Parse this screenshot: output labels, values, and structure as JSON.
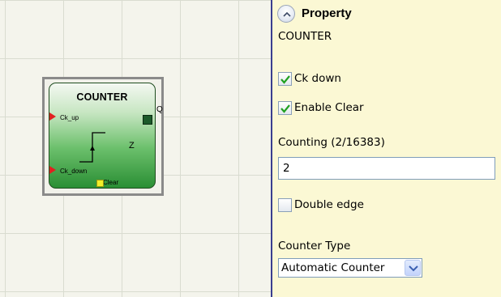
{
  "block": {
    "title": "COUNTER",
    "input_up": "Ck_up",
    "input_down": "Ck_down",
    "output": "Q",
    "value_symbol": "Z",
    "clear_input": "Clear"
  },
  "panel": {
    "header": "Property",
    "block_name": "COUNTER",
    "ck_down": {
      "label": "Ck down",
      "checked": true
    },
    "enable_clear": {
      "label": "Enable Clear",
      "checked": true
    },
    "counting": {
      "label": "Counting (2/16383)",
      "value": "2"
    },
    "double_edge": {
      "label": "Double edge",
      "checked": false
    },
    "counter_type": {
      "label": "Counter Type",
      "selected": "Automatic Counter"
    }
  },
  "colors": {
    "panel_bg": "#fbf8d4",
    "canvas_bg": "#f4f4ec",
    "block_green": "#2a8f34",
    "input_pin": "#e02020",
    "output_pin": "#1c5a2a",
    "clear_pin": "#f2ef2a",
    "check_mark": "#21a121"
  },
  "icons": {
    "collapse": "chevron-up-icon",
    "dropdown": "chevron-down-icon",
    "check": "checkmark-icon"
  }
}
